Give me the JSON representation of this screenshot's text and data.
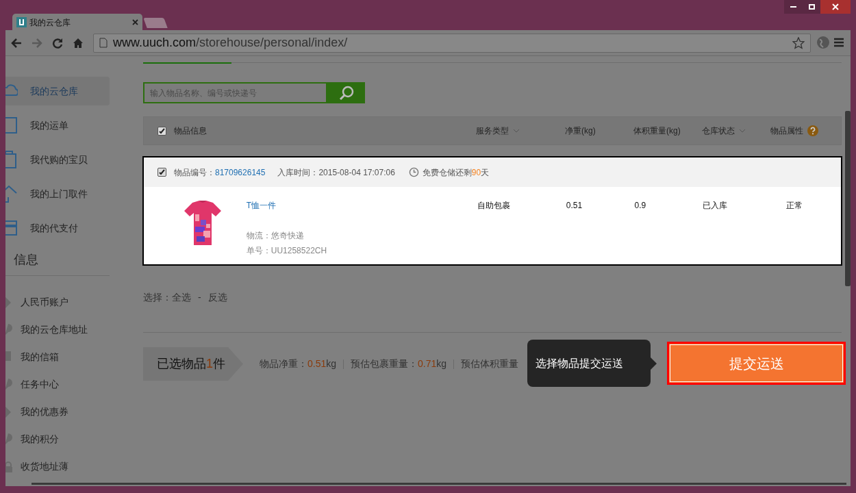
{
  "browser": {
    "tab_title": "我的云仓库",
    "url_host": "www.uuch.com",
    "url_path": "/storehouse/personal/index/"
  },
  "sidebar": {
    "items": [
      {
        "label": "我的云仓库",
        "selected": true
      },
      {
        "label": "我的运单",
        "selected": false
      },
      {
        "label": "我代购的宝贝",
        "selected": false
      },
      {
        "label": "我的上门取件",
        "selected": false
      },
      {
        "label": "我的代支付",
        "selected": false
      }
    ],
    "section_title": "信息",
    "account_items": [
      {
        "label": "人民币账户"
      },
      {
        "label": "我的云仓库地址"
      },
      {
        "label": "我的信箱"
      },
      {
        "label": "任务中心"
      },
      {
        "label": "我的优惠券"
      },
      {
        "label": "我的积分"
      },
      {
        "label": "收货地址薄"
      }
    ]
  },
  "search": {
    "placeholder": "输入物品名称、编号或快递号"
  },
  "table": {
    "header_checked": true,
    "columns": [
      {
        "label": "物品信息",
        "kind": "plain"
      },
      {
        "label": "服务类型",
        "kind": "dropdown"
      },
      {
        "label": "净重(kg)",
        "kind": "plain"
      },
      {
        "label": "体积重量(kg)",
        "kind": "plain"
      },
      {
        "label": "仓库状态",
        "kind": "dropdown"
      },
      {
        "label": "物品属性",
        "kind": "help"
      }
    ]
  },
  "item": {
    "checked": true,
    "id_label": "物品编号：",
    "id": "81709626145",
    "time_label": "入库时间：",
    "time": "2015-08-04 17:07:06",
    "storage_prefix": "免费仓储还剩",
    "storage_days": "90",
    "storage_suffix": "天",
    "name": "T恤一件",
    "logistics": "物流：悠奇快递",
    "number": "单号：UU1258522CH",
    "service": "自助包裹",
    "net_weight": "0.51",
    "volume_weight": "0.9",
    "status": "已入库",
    "attribute": "正常"
  },
  "selection": {
    "label": "选择：",
    "all": "全选",
    "separator": "-",
    "invert": "反选"
  },
  "summary": {
    "count_prefix": "已选物品",
    "count": "1",
    "count_suffix": "件",
    "stats": [
      {
        "label": "物品净重：",
        "value": "0.51",
        "unit": "kg"
      },
      {
        "label": "预估包裹重量：",
        "value": "0.71",
        "unit": "kg"
      },
      {
        "label": "预估体积重量"
      }
    ]
  },
  "tooltip": "选择物品提交运送",
  "submit_button": "提交运送"
}
